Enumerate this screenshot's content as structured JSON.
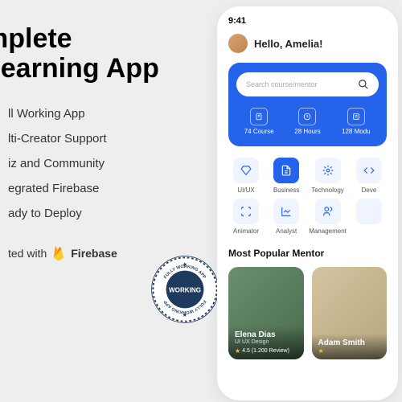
{
  "marketing": {
    "title_line1": "mplete",
    "title_line2": "Learning App",
    "features": [
      "ll Working App",
      "lti-Creator Support",
      "iz and Community",
      "egrated Firebase",
      "ady to Deploy"
    ],
    "created_label": "ted with",
    "firebase_label": "Firebase"
  },
  "badge": {
    "main": "WORKING",
    "ring": "FULLY WORKING APP"
  },
  "phone": {
    "time": "9:41",
    "greeting": "Hello, Amelia!",
    "search_placeholder": "Search course/mentor",
    "stats": [
      {
        "icon": "clipboard",
        "label": "74 Course"
      },
      {
        "icon": "clock",
        "label": "28 Hours"
      },
      {
        "icon": "modules",
        "label": "128 Modu"
      }
    ],
    "categories": [
      {
        "icon": "diamond",
        "label": "UI/UX",
        "active": false
      },
      {
        "icon": "document",
        "label": "Business",
        "active": true
      },
      {
        "icon": "gear",
        "label": "Technology",
        "active": false
      },
      {
        "icon": "code",
        "label": "Deve",
        "active": false
      },
      {
        "icon": "scan",
        "label": "Animator",
        "active": false
      },
      {
        "icon": "chart",
        "label": "Analyst",
        "active": false
      },
      {
        "icon": "people",
        "label": "Management",
        "active": false
      },
      {
        "icon": "blank",
        "label": "",
        "active": false
      }
    ],
    "section_title": "Most Popular Mentor",
    "mentors": [
      {
        "name": "Elena Dias",
        "role": "UI UX Design",
        "rating": "4.5 (1.200 Review)"
      },
      {
        "name": "Adam Smith",
        "role": "",
        "rating": ""
      }
    ]
  }
}
